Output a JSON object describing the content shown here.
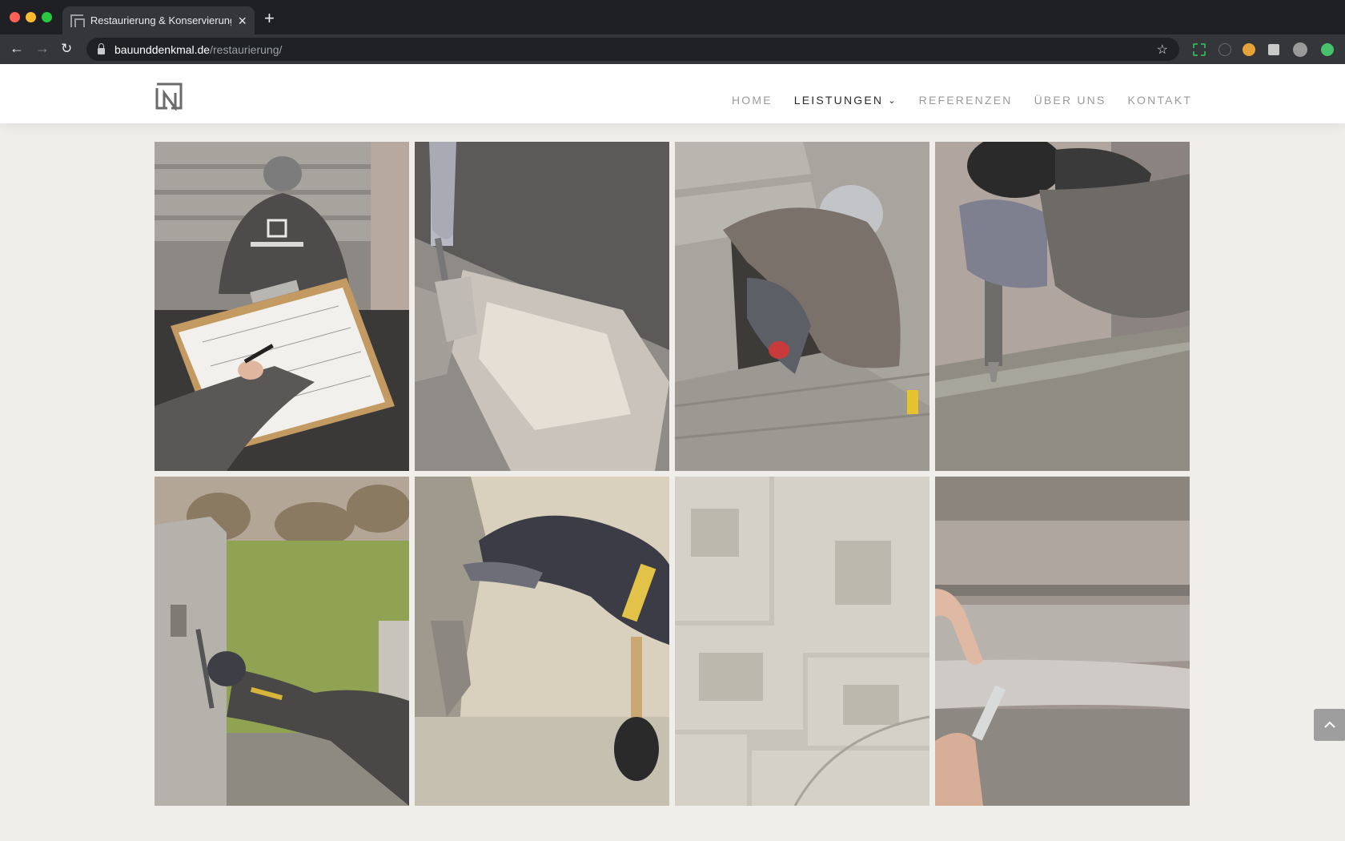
{
  "browser": {
    "tab_title": "Restaurierung & Konservierung",
    "url_host": "bauunddenkmal.de",
    "url_path": "/restaurierung/",
    "icons": [
      "back-icon",
      "forward-icon",
      "reload-icon",
      "lock-icon",
      "star-icon",
      "close-icon",
      "plus-icon",
      "puzzle-icon",
      "avatar"
    ]
  },
  "site": {
    "logo_icon": "ln-logo-icon",
    "nav": [
      {
        "label": "Home"
      },
      {
        "label": "Leistungen"
      },
      {
        "label": "Referenzen"
      },
      {
        "label": "Über uns"
      },
      {
        "label": "Kontakt"
      }
    ],
    "active_nav": "Leistungen"
  },
  "gallery": {
    "images": [
      {
        "subject": "worker-with-clipboard-plan"
      },
      {
        "subject": "trowel-mortar-on-stone"
      },
      {
        "subject": "worker-kneeling-stairwell"
      },
      {
        "subject": "chisel-on-stone-edge"
      },
      {
        "subject": "worker-repairing-stone-outdoors"
      },
      {
        "subject": "gloved-hand-with-brush"
      },
      {
        "subject": "stone-wall-blocks"
      },
      {
        "subject": "hand-on-stone-step"
      }
    ]
  },
  "colors": {
    "background": "#efeeea",
    "header": "#ffffff",
    "nav_inactive": "#9a9a9a",
    "nav_active": "#2b2b2b",
    "back_to_top": "#9e9e9e"
  },
  "back_to_top_icon": "chevron-up-icon"
}
